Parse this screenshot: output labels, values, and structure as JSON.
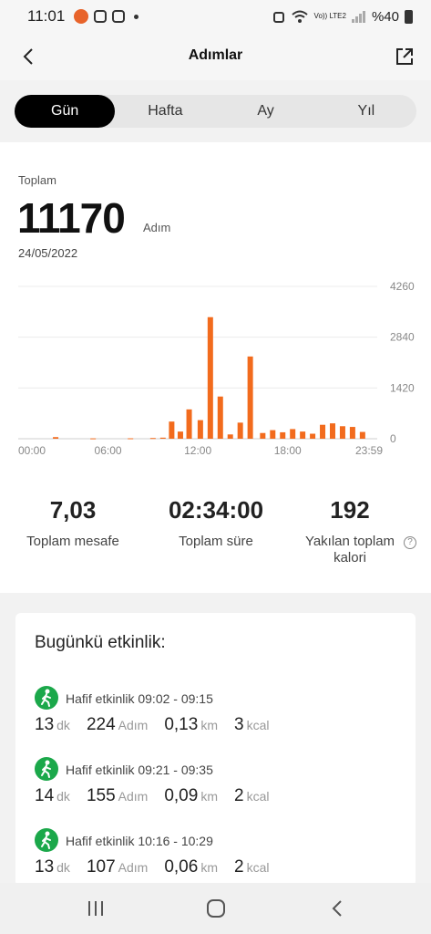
{
  "status_bar": {
    "time": "11:01",
    "network": "Vo)) LTE2",
    "battery": "%40"
  },
  "header": {
    "title": "Adımlar"
  },
  "tabs": [
    {
      "label": "Gün",
      "active": true
    },
    {
      "label": "Hafta",
      "active": false
    },
    {
      "label": "Ay",
      "active": false
    },
    {
      "label": "Yıl",
      "active": false
    }
  ],
  "summary": {
    "total_label": "Toplam",
    "total_value": "11170",
    "total_unit": "Adım",
    "date": "24/05/2022"
  },
  "chart_data": {
    "type": "bar",
    "x_ticks": [
      "00:00",
      "06:00",
      "12:00",
      "18:00",
      "23:59"
    ],
    "y_ticks": [
      "4260",
      "2840",
      "1420",
      "0"
    ],
    "ylim": [
      0,
      4260
    ],
    "categories": [
      "02:30",
      "05:00",
      "07:30",
      "09:00",
      "09:40",
      "10:15",
      "10:50",
      "11:25",
      "12:10",
      "12:50",
      "13:30",
      "14:10",
      "14:50",
      "15:30",
      "16:20",
      "17:00",
      "17:40",
      "18:20",
      "19:00",
      "19:40",
      "20:20",
      "21:00",
      "21:40",
      "22:20",
      "23:00"
    ],
    "values": [
      45,
      10,
      12,
      20,
      30,
      480,
      200,
      820,
      520,
      3400,
      1180,
      120,
      450,
      2300,
      160,
      240,
      180,
      270,
      200,
      140,
      390,
      430,
      350,
      330,
      190
    ],
    "bar_color": "#f26b1d",
    "grid": true
  },
  "stats": [
    {
      "value": "7,03",
      "label": "Toplam mesafe"
    },
    {
      "value": "02:34:00",
      "label": "Toplam süre"
    },
    {
      "value": "192",
      "label": "Yakılan toplam kalori"
    }
  ],
  "activity": {
    "title": "Bugünkü etkinlik:",
    "items": [
      {
        "name": "Hafif etkinlik 09:02 - 09:15",
        "minutes": "13",
        "min_unit": "dk",
        "steps": "224",
        "steps_unit": "Adım",
        "distance": "0,13",
        "distance_unit": "km",
        "calories": "3",
        "calories_unit": "kcal"
      },
      {
        "name": "Hafif etkinlik 09:21 - 09:35",
        "minutes": "14",
        "min_unit": "dk",
        "steps": "155",
        "steps_unit": "Adım",
        "distance": "0,09",
        "distance_unit": "km",
        "calories": "2",
        "calories_unit": "kcal"
      },
      {
        "name": "Hafif etkinlik 10:16 - 10:29",
        "minutes": "13",
        "min_unit": "dk",
        "steps": "107",
        "steps_unit": "Adım",
        "distance": "0,06",
        "distance_unit": "km",
        "calories": "2",
        "calories_unit": "kcal"
      }
    ]
  },
  "colors": {
    "accent": "#f26b1d",
    "activity_icon": "#1ba84a",
    "tab_active": "#000000"
  }
}
